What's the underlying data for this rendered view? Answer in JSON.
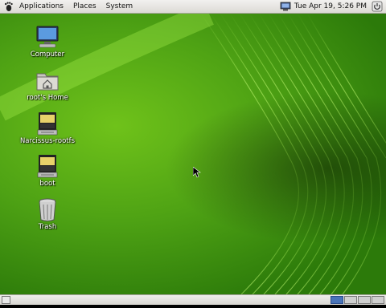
{
  "top_panel": {
    "menus": [
      "Applications",
      "Places",
      "System"
    ],
    "clock": "Tue Apr 19,  5:26 PM"
  },
  "desktop": {
    "icons": [
      {
        "label": "Computer"
      },
      {
        "label": "root's Home"
      },
      {
        "label": "Narcissus-rootfs"
      },
      {
        "label": "boot"
      },
      {
        "label": "Trash"
      }
    ]
  },
  "bottom_panel": {
    "workspaces": 4,
    "active_workspace": 1
  },
  "colors": {
    "wallpaper_green": "#4ea214",
    "workspace_active": "#4a74b8"
  }
}
